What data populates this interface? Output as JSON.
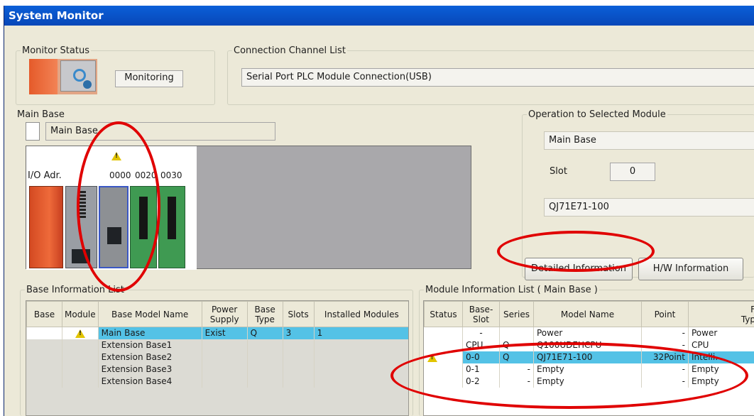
{
  "window": {
    "title": "System Monitor"
  },
  "monitor_status": {
    "legend": "Monitor Status",
    "value": "Monitoring"
  },
  "connection": {
    "legend": "Connection Channel List",
    "value": "Serial Port  PLC Module Connection(USB)"
  },
  "main_base": {
    "legend": "Main Base",
    "selector_label": "Main Base",
    "io_label": "I/O Adr.",
    "io_addresses": [
      "0000",
      "0020",
      "0030"
    ]
  },
  "operation": {
    "legend": "Operation to Selected Module",
    "base": "Main Base",
    "slot_label": "Slot",
    "slot_value": "0",
    "model": "QJ71E71-100",
    "detailed_button": "Detailed Information",
    "hw_button": "H/W Information"
  },
  "base_list": {
    "legend": "Base Information List",
    "headers": [
      "Base",
      "Module",
      "Base Model Name",
      "Power Supply",
      "Base Type",
      "Slots",
      "Installed Modules"
    ],
    "rows": [
      {
        "base": "",
        "module": "warning-icon",
        "name": "Main Base",
        "power": "Exist",
        "type": "Q",
        "slots": "3",
        "installed": "1"
      },
      {
        "base": "",
        "module": "",
        "name": "Extension Base1",
        "power": "",
        "type": "",
        "slots": "",
        "installed": ""
      },
      {
        "base": "",
        "module": "",
        "name": "Extension Base2",
        "power": "",
        "type": "",
        "slots": "",
        "installed": ""
      },
      {
        "base": "",
        "module": "",
        "name": "Extension Base3",
        "power": "",
        "type": "",
        "slots": "",
        "installed": ""
      },
      {
        "base": "",
        "module": "",
        "name": "Extension Base4",
        "power": "",
        "type": "",
        "slots": "",
        "installed": ""
      }
    ]
  },
  "module_list": {
    "legend": "Module Information List ( Main Base )",
    "headers": [
      "Status",
      "Base-Slot",
      "Series",
      "Model Name",
      "Point",
      "Typ"
    ],
    "header_partial": "F",
    "rows": [
      {
        "status": "",
        "slot": "-",
        "series": "",
        "model": "Power",
        "point": "-",
        "type": "Power"
      },
      {
        "status": "",
        "slot": "CPU",
        "series": "Q",
        "model": "Q100UDEHCPU",
        "point": "-",
        "type": "CPU"
      },
      {
        "status": "warning-icon",
        "slot": "0-0",
        "series": "Q",
        "model": "QJ71E71-100",
        "point": "32Point",
        "type": "Intelli."
      },
      {
        "status": "",
        "slot": "0-1",
        "series": "-",
        "model": "Empty",
        "point": "-",
        "type": "Empty"
      },
      {
        "status": "",
        "slot": "0-2",
        "series": "-",
        "model": "Empty",
        "point": "-",
        "type": "Empty"
      }
    ]
  },
  "colors": {
    "title_bar": "#0a5fd8",
    "selected_row": "#54c2e6",
    "annotation": "#e00000",
    "warning": "#e2c400"
  }
}
